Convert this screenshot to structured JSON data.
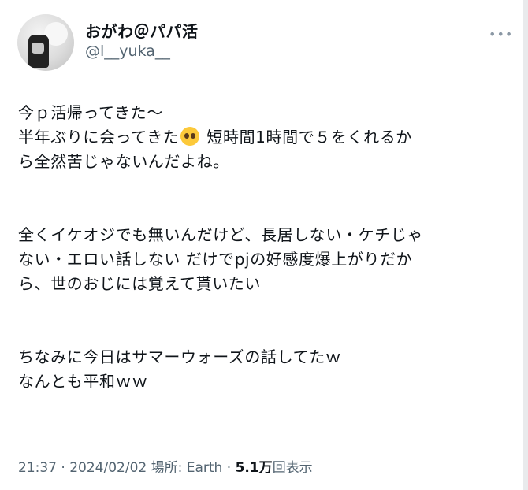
{
  "profile": {
    "display_name": "おがわ＠パパ活",
    "handle": "@l__yuka__",
    "more_icon": "more-dots-icon",
    "avatar_icon": "avatar-photo"
  },
  "tweet": {
    "lines": [
      "今ｐ活帰ってきた〜",
      "半年ぶりに会ってきた",
      "短時間1時間で５をくれるか",
      "ら全然苦じゃないんだよね。",
      "全くイケオジでも無いんだけど、長居しない・ケチじゃ",
      "ない・エロい話しない だけでpjの好感度爆上がりだか",
      "ら、世のおじには覚えて貰いたい",
      "ちなみに今日はサマーウォーズの話してたｗ",
      "なんとも平和ｗｗ"
    ],
    "emoji": "pleading-face-emoji"
  },
  "meta": {
    "time": "21:37",
    "sep1": "·",
    "date": "2024/02/02",
    "location": "場所: Earth",
    "sep2": "·",
    "views_count": "5.1万",
    "views_label": "回表示"
  }
}
